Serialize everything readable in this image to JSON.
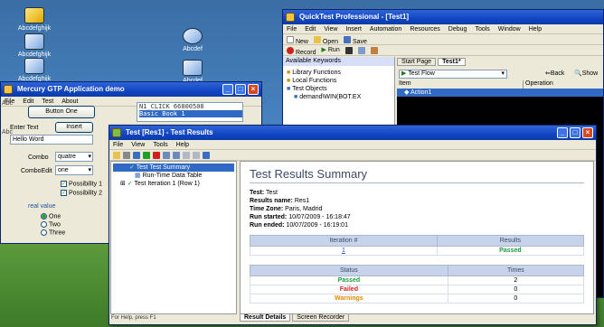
{
  "desktop": {
    "icons": [
      {
        "label": "Abcdefghijk"
      },
      {
        "label": "Abcdefghijk"
      },
      {
        "label": "Abcdefghijk"
      },
      {
        "label": "Abcdef"
      },
      {
        "label": "Abcdef"
      }
    ]
  },
  "qtp": {
    "title": "QuickTest Professional - [Test1]",
    "menu": [
      "File",
      "Edit",
      "View",
      "Insert",
      "Automation",
      "Resources",
      "Debug",
      "Tools",
      "Window",
      "Help"
    ],
    "toolbar1": {
      "new": "New",
      "open": "Open",
      "save": "Save"
    },
    "toolbar2": {
      "record": "Record",
      "run": "Run"
    },
    "keywords_pane": {
      "title": "Available Keywords",
      "items": [
        "Library Functions",
        "Local Functions",
        "Test Objects",
        "demand\\WIN(BOT.EX"
      ]
    },
    "tabs": [
      "Start Page",
      "Test1*"
    ],
    "flow_select": "Test Flow",
    "nav": {
      "back": "Back",
      "show": "Show"
    },
    "grid_headers": {
      "item": "Item",
      "operation": "Operation"
    },
    "grid_row": "Action1"
  },
  "demo_app": {
    "title": "Mercury GTP Application demo",
    "menu": [
      "File",
      "Edit",
      "Test",
      "About"
    ],
    "button_one": "Button One",
    "log_lines": [
      "N1_CLICK 66800508",
      "Basic Book 1"
    ],
    "enter_text_label": "Enter Text",
    "insert_button": "Insert",
    "hello_value": "Hello Word",
    "combo_label": "Combo",
    "combo_value": "quatre",
    "comboedit_label": "ComboEdit",
    "comboedit_value": "one",
    "checks": [
      {
        "label": "Possibility 1",
        "checked": true
      },
      {
        "label": "Possibility 2",
        "checked": true
      }
    ],
    "radio_label": "real value",
    "radios": [
      {
        "label": "One",
        "selected": true
      },
      {
        "label": "Two",
        "selected": false
      },
      {
        "label": "Three",
        "selected": false
      }
    ],
    "side_labels": [
      "Abc",
      "Abc"
    ]
  },
  "results": {
    "title": "Test [Res1] - Test Results",
    "menu": [
      "File",
      "View",
      "Tools",
      "Help"
    ],
    "tree": [
      "Test Test Summary",
      "Run-Time Data Table",
      "Test Iteration 1 (Row 1)"
    ],
    "summary_title": "Test Results Summary",
    "info": [
      {
        "label": "Test:",
        "value": "Test"
      },
      {
        "label": "Results name:",
        "value": "Res1"
      },
      {
        "label": "Time Zone:",
        "value": "Paris, Madrid"
      },
      {
        "label": "Run started:",
        "value": "10/07/2009 - 16:18:47"
      },
      {
        "label": "Run ended:",
        "value": "10/07/2009 - 16:19:01"
      }
    ],
    "iteration_table": {
      "headers": [
        "Iteration #",
        "Results"
      ],
      "row": [
        "1",
        "Passed"
      ]
    },
    "status_table": {
      "headers": [
        "Status",
        "Times"
      ],
      "rows": [
        {
          "status": "Passed",
          "times": "2",
          "color": "#1e9a3a"
        },
        {
          "status": "Failed",
          "times": "0",
          "color": "#d02020"
        },
        {
          "status": "Warnings",
          "times": "0",
          "color": "#e08a00"
        }
      ]
    },
    "tabs": [
      "Result Details",
      "Screen Recorder"
    ],
    "status_bar": "For Help, press F1"
  }
}
